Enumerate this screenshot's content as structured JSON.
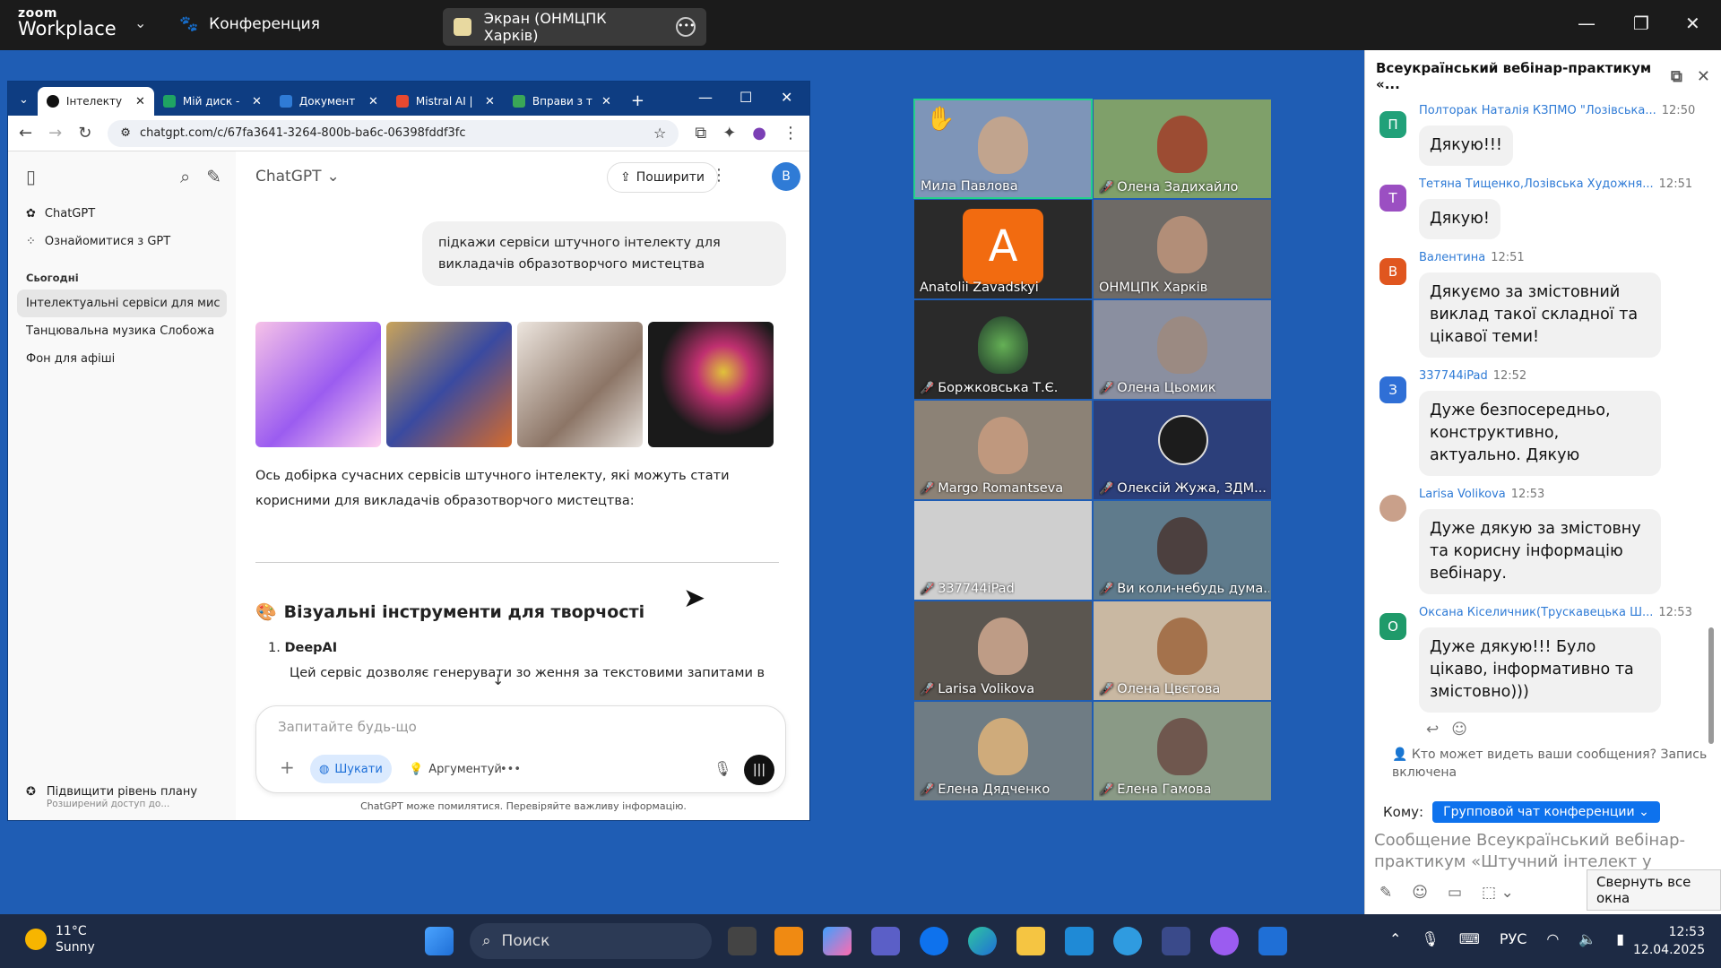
{
  "zoom": {
    "logo_line1": "zoom",
    "logo_line2": "Workplace",
    "conference_label": "Конференция",
    "screen_share_label": "Экран (ОНМЦПК Харків)"
  },
  "browser": {
    "tabs": [
      {
        "label": "Інтелекту",
        "color": "#111111"
      },
      {
        "label": "Мій диск -",
        "color": "#1fa463"
      },
      {
        "label": "Документ",
        "color": "#2f7bd6"
      },
      {
        "label": "Mistral AI |",
        "color": "#e8492f"
      },
      {
        "label": "Вправи з т",
        "color": "#3aa757"
      }
    ],
    "url": "chatgpt.com/c/67fa3641-3264-800b-ba6c-06398fddf3fc"
  },
  "gpt": {
    "sidebar": {
      "items": [
        "ChatGPT",
        "Ознайомитися з GPT"
      ],
      "today_heading": "Сьогодні",
      "chats": [
        "Інтелектуальні сервіси для мис",
        "Танцювальна музика Слобожа",
        "Фон для афіші"
      ],
      "upgrade_title": "Підвищити рівень плану",
      "upgrade_sub": "Розширений доступ до..."
    },
    "header": {
      "model": "ChatGPT",
      "share": "Поширити",
      "avatar": "B"
    },
    "user_message": "підкажи сервіси штучного інтелекту для викладачів образотворчого мистецтва",
    "answer_intro": "Ось добірка сучасних сервісів штучного інтелекту, які можуть стати корисними для викладачів образотворчого мистецтва:",
    "section_title": "Візуальні інструменти для творчості",
    "item_number": "1.",
    "item_title": "DeepAI",
    "item_text": "Цей сервіс дозволяє генерувати зо   ження за текстовими запитами в",
    "composer_placeholder": "Запитайте будь-що",
    "search_pill": "Шукати",
    "reason_pill": "Аргументуй",
    "disclaimer": "ChatGPT може помилятися. Перевіряйте важливу інформацію."
  },
  "participants": [
    {
      "name": "Мила Павлова",
      "muted": false,
      "bg": "#7e95b8"
    },
    {
      "name": "Олена Задихайло",
      "muted": true,
      "bg": "#7fa06a"
    },
    {
      "name": "Anatolii Zavadskyi",
      "muted": false,
      "bg": "#2a2a2a"
    },
    {
      "name": "ОНМЦПК Харків",
      "muted": false,
      "bg": "#6e6a66"
    },
    {
      "name": "Боржковська Т.Є.",
      "muted": true,
      "bg": "#2a2a2a"
    },
    {
      "name": "Олена Цьомик",
      "muted": true,
      "bg": "#8a8fa0"
    },
    {
      "name": "Margo Romantseva",
      "muted": true,
      "bg": "#8c8276"
    },
    {
      "name": "Олексій Жужа, ЗДМ...",
      "muted": true,
      "bg": "#2c3f7a"
    },
    {
      "name": "337744iPad",
      "muted": true,
      "bg": "#cfcfcf"
    },
    {
      "name": "Ви коли-небудь дума...",
      "muted": true,
      "bg": "#5f7b8c"
    },
    {
      "name": "Larisa Volikova",
      "muted": true,
      "bg": "#5b5650"
    },
    {
      "name": "Олена Цвєтова",
      "muted": true,
      "bg": "#c9b8a2"
    },
    {
      "name": "Елена Дядченко",
      "muted": true,
      "bg": "#6f7c84"
    },
    {
      "name": "Елена Гамова",
      "muted": true,
      "bg": "#8a9a86"
    }
  ],
  "chat": {
    "title": "Всеукраїнський вебінар-практикум «...",
    "messages": [
      {
        "initial": "П",
        "color": "#21a179",
        "sender": "Полторак Наталія КЗПМО \"Лозівська...",
        "time": "12:50",
        "text": "Дякую!!!"
      },
      {
        "initial": "Т",
        "color": "#9b4fc2",
        "sender": "Тетяна Тищенко,Лозівська Художня...",
        "time": "12:51",
        "text": "Дякую!"
      },
      {
        "initial": "В",
        "color": "#e0561f",
        "sender": "Валентина",
        "time": "12:51",
        "text": "Дякуємо за змістовний виклад такої складної та цікавої теми!"
      },
      {
        "initial": "З",
        "color": "#2f6fd6",
        "sender": "337744iPad",
        "time": "12:52",
        "text": "Дуже безпосередньо, конструктивно, актуально. Дякую"
      },
      {
        "initial": "",
        "color": "#c9a08a",
        "sender": "Larisa Volikova",
        "time": "12:53",
        "text": "Дуже дякую за змістовну та корисну інформацію вебінару."
      },
      {
        "initial": "О",
        "color": "#1f9a6a",
        "sender": "Оксана Кiселичник(Трускавецька Ш...",
        "time": "12:53",
        "text": "Дуже дякую!!! Було цікаво, інформативно та змістовно)))"
      }
    ],
    "who_sees": "Кто может видеть ваши сообщения? Запись включена",
    "to_label": "Кому:",
    "to_value": "Групповой чат конференции",
    "compose_placeholder": "Сообщение Всеукраїнський вебінар-практикум «Штучний інтелект у",
    "collapse_tooltip": "Свернуть все окна"
  },
  "taskbar": {
    "temp": "11°C",
    "condition": "Sunny",
    "search": "Поиск",
    "lang": "РУС",
    "time": "12:53",
    "date": "12.04.2025"
  }
}
